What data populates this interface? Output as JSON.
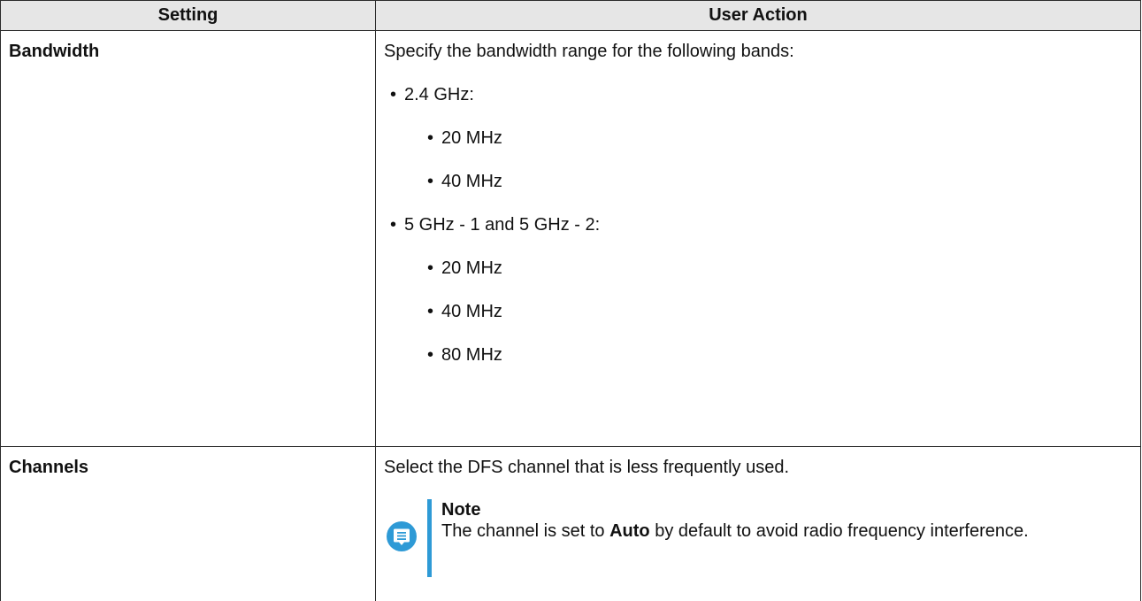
{
  "table": {
    "headers": {
      "setting": "Setting",
      "user_action": "User Action"
    },
    "rows": [
      {
        "setting": "Bandwidth",
        "intro": "Specify the bandwidth range for the following bands:",
        "groups": [
          {
            "label": "2.4 GHz:",
            "items": [
              "20 MHz",
              "40 MHz"
            ]
          },
          {
            "label": "5 GHz - 1 and 5 GHz - 2:",
            "items": [
              "20 MHz",
              "40 MHz",
              "80 MHz"
            ]
          }
        ]
      },
      {
        "setting": "Channels",
        "intro": "Select the DFS channel that is less frequently used.",
        "note": {
          "title": "Note",
          "text_before": "The channel is set to ",
          "text_bold": "Auto",
          "text_after": " by default to avoid radio frequency interference."
        }
      }
    ]
  },
  "bullet_char": "•",
  "colors": {
    "header_bg": "#e6e6e6",
    "border": "#2b2b2b",
    "note_accent": "#2e9ad6"
  },
  "icons": {
    "note": "note-icon"
  }
}
